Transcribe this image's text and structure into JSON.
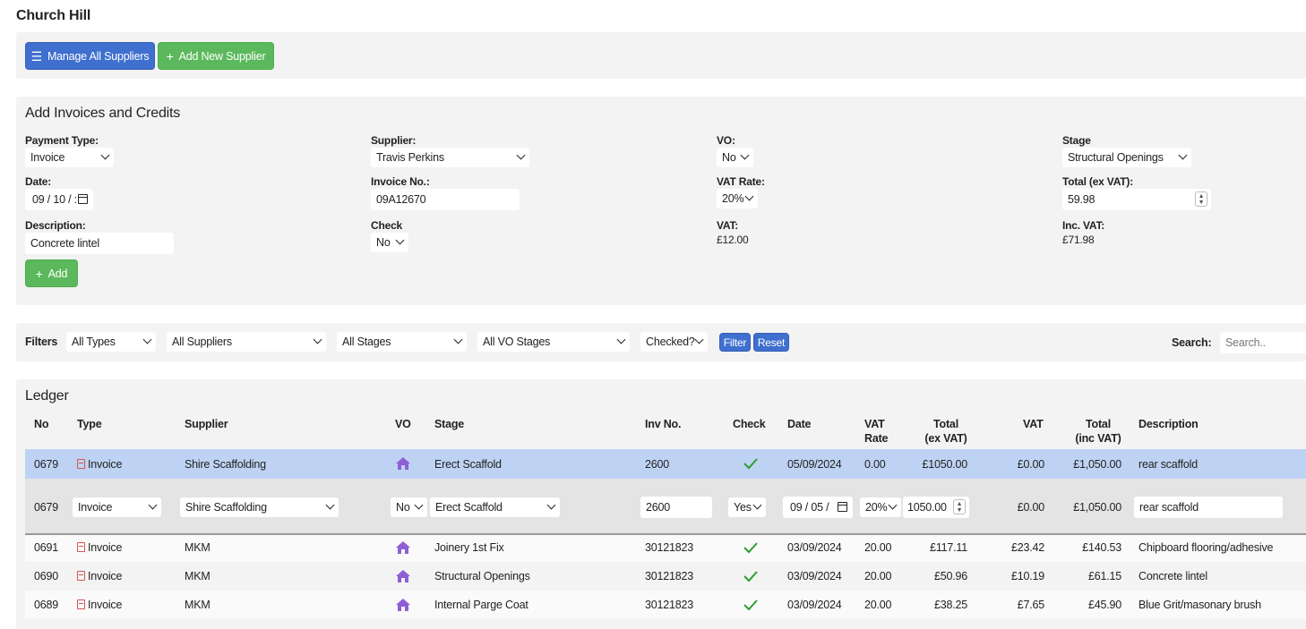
{
  "page": {
    "title": "Church Hill"
  },
  "toolbar": {
    "manage_label": "Manage All Suppliers",
    "add_label": "Add New Supplier"
  },
  "form": {
    "title": "Add Invoices and Credits",
    "payment_type": {
      "label": "Payment Type:",
      "value": "Invoice"
    },
    "date": {
      "label": "Date:",
      "value": "09 / 10 / :"
    },
    "description": {
      "label": "Description:",
      "value": "Concrete lintel"
    },
    "supplier": {
      "label": "Supplier:",
      "value": "Travis Perkins"
    },
    "invoice_no": {
      "label": "Invoice No.:",
      "value": "09A12670"
    },
    "check": {
      "label": "Check",
      "value": "No"
    },
    "vo": {
      "label": "VO:",
      "value": "No"
    },
    "vat_rate": {
      "label": "VAT Rate:",
      "value": "20%"
    },
    "vat": {
      "label": "VAT:",
      "value": "£12.00"
    },
    "stage": {
      "label": "Stage",
      "value": "Structural Openings"
    },
    "total_ex": {
      "label": "Total (ex VAT):",
      "value": "59.98"
    },
    "inc_vat": {
      "label": "Inc. VAT:",
      "value": "£71.98"
    },
    "add_label": "Add"
  },
  "filters": {
    "label": "Filters",
    "types": "All Types",
    "suppliers": "All Suppliers",
    "stages": "All Stages",
    "vo_stages": "All VO Stages",
    "checked": "Checked?",
    "filter_label": "Filter",
    "reset_label": "Reset",
    "search_label": "Search:",
    "search_placeholder": "Search.."
  },
  "ledger": {
    "title": "Ledger",
    "headers": {
      "no": "No",
      "type": "Type",
      "supplier": "Supplier",
      "vo": "VO",
      "stage": "Stage",
      "inv_no": "Inv No.",
      "check": "Check",
      "date": "Date",
      "vat_rate_1": "VAT",
      "vat_rate_2": "Rate",
      "total_ex_1": "Total",
      "total_ex_2": "(ex VAT)",
      "vat": "VAT",
      "total_inc_1": "Total",
      "total_inc_2": "(inc VAT)",
      "description": "Description"
    },
    "selected_row": {
      "no": "0679",
      "type": "Invoice",
      "supplier": "Shire Scaffolding",
      "stage": "Erect Scaffold",
      "inv_no": "2600",
      "date": "05/09/2024",
      "vat_rate": "0.00",
      "total_ex": "£1050.00",
      "vat": "£0.00",
      "total_inc": "£1,050.00",
      "description": "rear scaffold"
    },
    "edit_row": {
      "no": "0679",
      "type": "Invoice",
      "supplier": "Shire Scaffolding",
      "vo": "No",
      "stage": "Erect Scaffold",
      "inv_no": "2600",
      "check": "Yes",
      "date": "09 / 05 /",
      "vat_rate": "20%",
      "total_ex": "1050.00",
      "vat": "£0.00",
      "total_inc": "£1,050.00",
      "description": "rear scaffold"
    },
    "rows": [
      {
        "no": "0691",
        "type": "Invoice",
        "supplier": "MKM",
        "stage": "Joinery 1st Fix",
        "inv_no": "30121823",
        "date": "03/09/2024",
        "vat_rate": "20.00",
        "total_ex": "£117.11",
        "vat": "£23.42",
        "total_inc": "£140.53",
        "description": "Chipboard flooring/adhesive"
      },
      {
        "no": "0690",
        "type": "Invoice",
        "supplier": "MKM",
        "stage": "Structural Openings",
        "inv_no": "30121823",
        "date": "03/09/2024",
        "vat_rate": "20.00",
        "total_ex": "£50.96",
        "vat": "£10.19",
        "total_inc": "£61.15",
        "description": "Concrete lintel"
      },
      {
        "no": "0689",
        "type": "Invoice",
        "supplier": "MKM",
        "stage": "Internal Parge Coat",
        "inv_no": "30121823",
        "date": "03/09/2024",
        "vat_rate": "20.00",
        "total_ex": "£38.25",
        "vat": "£7.65",
        "total_inc": "£45.90",
        "description": "Blue Grit/masonary brush"
      }
    ]
  },
  "colors": {
    "accent_blue": "#3f6fcf",
    "accent_green": "#5cb85c",
    "selected_row": "#bed3f3",
    "vo_icon": "#8e5fd6",
    "check_icon": "#2ca02c",
    "pdf_icon": "#d9534f"
  }
}
